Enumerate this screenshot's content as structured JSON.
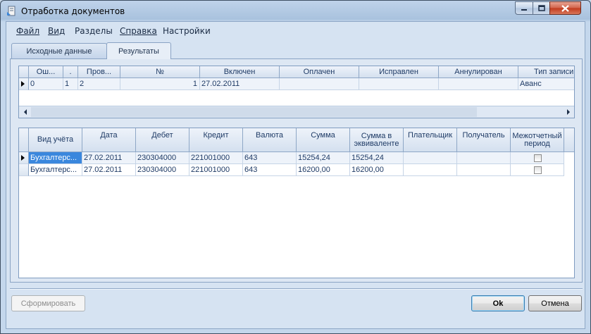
{
  "window": {
    "title": "Отработка документов"
  },
  "menu": [
    {
      "label": "Файл"
    },
    {
      "label": "Вид"
    },
    {
      "label": "Разделы"
    },
    {
      "label": "Справка"
    },
    {
      "label": "Настройки"
    }
  ],
  "tabs": [
    {
      "label": "Исходные данные"
    },
    {
      "label": "Результаты"
    }
  ],
  "top_grid": {
    "columns": [
      "Ош...",
      ".",
      "Пров...",
      "№",
      "Включен",
      "Оплачен",
      "Исправлен",
      "Аннулирован",
      "Тип записи"
    ],
    "rows": [
      [
        "0",
        "1",
        "2",
        "1",
        "27.02.2011",
        "",
        "",
        "",
        "Аванс"
      ]
    ]
  },
  "bottom_grid": {
    "columns": [
      "Вид учёта",
      "Дата",
      "Дебет",
      "Кредит",
      "Валюта",
      "Сумма",
      "Сумма в эквиваленте",
      "Плательщик",
      "Получатель",
      "Межотчетный период"
    ],
    "rows": [
      [
        "Бухгалтерс...",
        "27.02.2011",
        "230304000",
        "221001000",
        "643",
        "15254,24",
        "15254,24",
        "",
        "",
        ""
      ],
      [
        "Бухгалтерс...",
        "27.02.2011",
        "230304000",
        "221001000",
        "643",
        "16200,00",
        "16200,00",
        "",
        "",
        ""
      ]
    ]
  },
  "buttons": {
    "generate": "Сформировать",
    "ok": "Ok",
    "cancel": "Отмена"
  }
}
